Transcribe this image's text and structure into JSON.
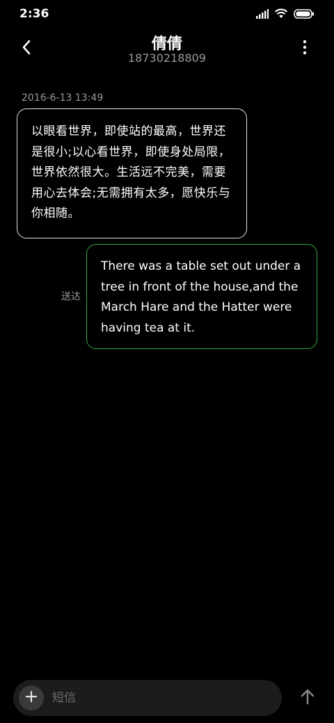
{
  "status_bar": {
    "time": "2:36",
    "icons": [
      "signal-icon",
      "wifi-icon",
      "battery-icon"
    ]
  },
  "header": {
    "contact_name": "倩倩",
    "contact_number": "18730218809",
    "back_icon": "chevron-left-icon",
    "more_icon": "more-vertical-icon"
  },
  "messages": [
    {
      "direction": "incoming",
      "timestamp": "2016-6-13 13:49",
      "text": "以眼看世界，即使站的最高，世界还是很小;以心看世界，即使身处局限，世界依然很大。生活远不完美，需要用心去体会;无需拥有太多，愿快乐与你相随。"
    },
    {
      "direction": "outgoing",
      "status": "送达",
      "text": "There was a table set out under a tree in front of the house,and the March Hare and the Hatter were having tea at it."
    }
  ],
  "composer": {
    "placeholder": "短信",
    "value": "",
    "add_icon": "plus-icon",
    "send_icon": "arrow-up-icon"
  },
  "colors": {
    "background": "#000000",
    "incoming_border": "#e8e8e8",
    "outgoing_border": "#35a845",
    "secondary_text": "#9a9a9a",
    "composer_bg": "#1c1c1c"
  }
}
